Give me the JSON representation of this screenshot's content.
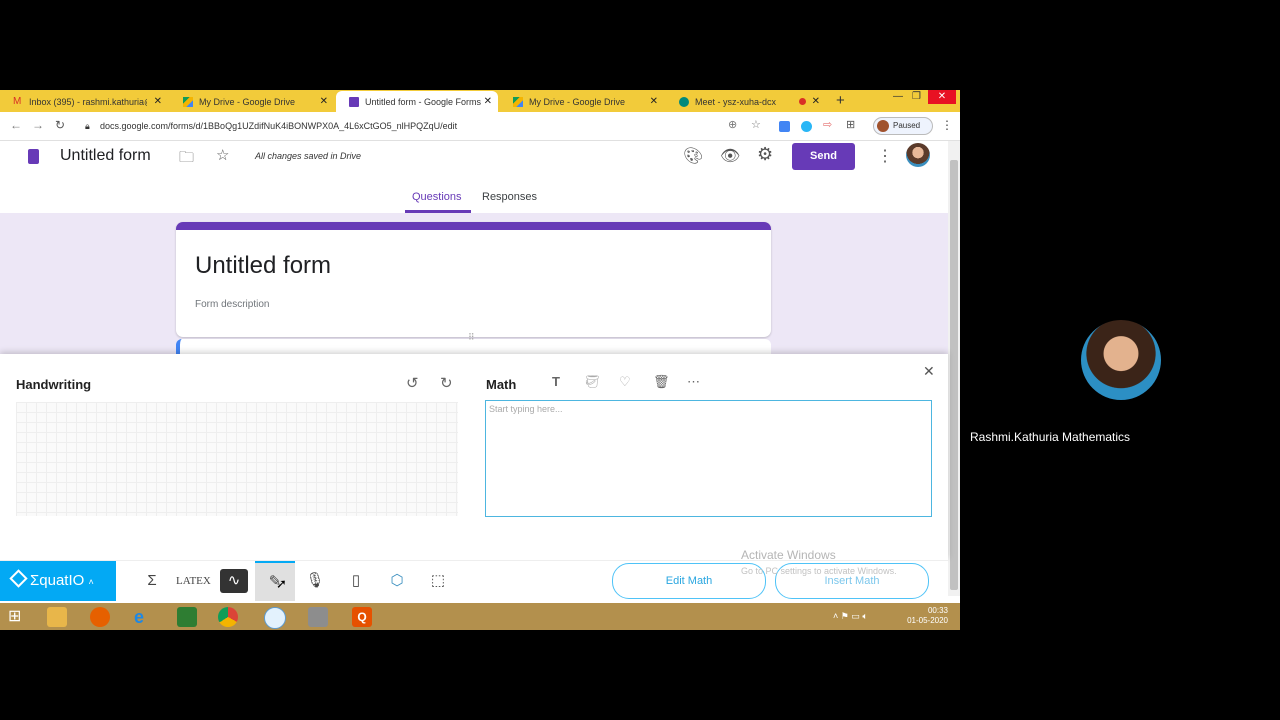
{
  "browser": {
    "tabs": [
      {
        "label": "Inbox (395) - rashmi.kathuria@",
        "icon": "gmail-icon",
        "active": false
      },
      {
        "label": "My Drive - Google Drive",
        "icon": "drive-icon",
        "active": false
      },
      {
        "label": "Untitled form - Google Forms",
        "icon": "forms-icon",
        "active": true
      },
      {
        "label": "My Drive - Google Drive",
        "icon": "drive-icon",
        "active": false
      },
      {
        "label": "Meet - ysz-xuha-dcx",
        "icon": "meet-icon",
        "active": false
      }
    ],
    "new_tab": "+",
    "url": "docs.google.com/forms/d/1BBoQg1UZdifNuK4iBONWPX0A_4L6xCtGO5_nlHPQZqU/edit",
    "profile_status": "Paused"
  },
  "forms": {
    "app_title": "Untitled form",
    "save_status": "All changes saved in Drive",
    "send_label": "Send",
    "tabs": {
      "questions": "Questions",
      "responses": "Responses"
    },
    "form_title": "Untitled form",
    "form_description": "Form description"
  },
  "equatio": {
    "handwriting_title": "Handwriting",
    "math_title": "Math",
    "math_placeholder": "Start typing here...",
    "logo": "ƩquatIO",
    "toolbar": [
      "sigma-icon",
      "latex-icon",
      "graph-icon",
      "handwriting-icon",
      "microphone-icon",
      "mobile-icon",
      "3d-shape-icon",
      "screenshot-select-icon"
    ],
    "latex_label": "LATEX",
    "edit_math_label": "Edit Math",
    "insert_math_label": "Insert Math"
  },
  "watermark": {
    "line1": "Activate Windows",
    "line2": "Go to PC settings to activate Windows."
  },
  "taskbar": {
    "time": "00:33",
    "date": "01-05-2020"
  },
  "meet": {
    "participant_name": "Rashmi.Kathuria Mathematics"
  },
  "colors": {
    "forms_purple": "#673ab7",
    "equatio_blue": "#03a9f4",
    "tabbar_yellow": "#f2cb3a"
  }
}
